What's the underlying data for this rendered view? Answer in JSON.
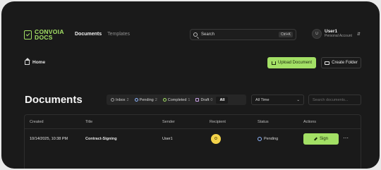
{
  "header": {
    "logo_line1": "CONVOIA",
    "logo_line2": "DOCS",
    "nav": {
      "documents": "Documents",
      "templates": "Templates"
    },
    "search": {
      "label": "Search",
      "shortcut": "Ctrl+K"
    },
    "user": {
      "initial": "U",
      "name": "User1",
      "role": "Personal Account"
    }
  },
  "breadcrumb": {
    "home": "Home"
  },
  "actions": {
    "upload": "Upload Document",
    "create_folder": "Create Folder"
  },
  "page_title": "Documents",
  "filters": {
    "inbox": {
      "label": "Inbox",
      "count": "2"
    },
    "pending": {
      "label": "Pending",
      "count": "2"
    },
    "completed": {
      "label": "Completed",
      "count": "1"
    },
    "draft": {
      "label": "Draft",
      "count": "0"
    },
    "all": {
      "label": "All"
    }
  },
  "time_filter": {
    "selected": "All Time"
  },
  "doc_search": {
    "placeholder": "Search documents..."
  },
  "table": {
    "columns": [
      "Created",
      "Title",
      "Sender",
      "Recipient",
      "Status",
      "Actions"
    ],
    "rows": [
      {
        "created": "10/14/2025, 10:38 PM",
        "title": "Contract-Signing",
        "sender": "User1",
        "recipient_initial": "O",
        "status": "Pending",
        "action": "Sign"
      }
    ]
  },
  "colors": {
    "accent": "#a3e065",
    "background": "#1a1a1a",
    "recipient_badge": "#f3d34a"
  }
}
